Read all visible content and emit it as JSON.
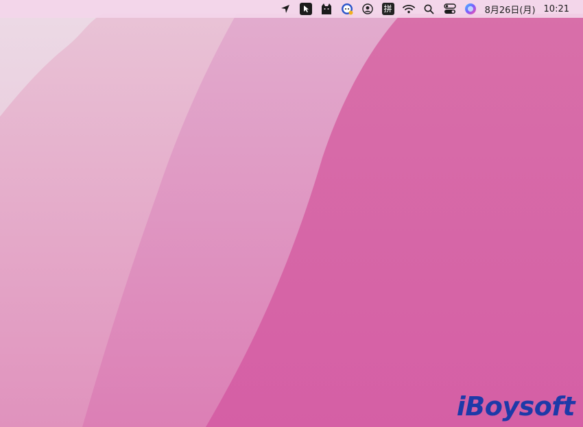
{
  "menubar": {
    "icons": [
      "location-arrow-icon",
      "cursor-app-icon",
      "cat-app-icon",
      "chat-bubble-icon",
      "user-account-icon",
      "pinyin-input-icon",
      "wifi-icon",
      "spotlight-search-icon",
      "control-center-icon",
      "siri-icon"
    ],
    "input_method_label": "拼",
    "date": "8月26日(月)",
    "time": "10:21"
  },
  "watermark": {
    "text": "iBoysoft",
    "color": "#1d3aa8"
  },
  "colors": {
    "menubar": "#f3d6ea",
    "wallpaper_light": "#e7c7dc",
    "wallpaper_dark": "#d760a6"
  }
}
